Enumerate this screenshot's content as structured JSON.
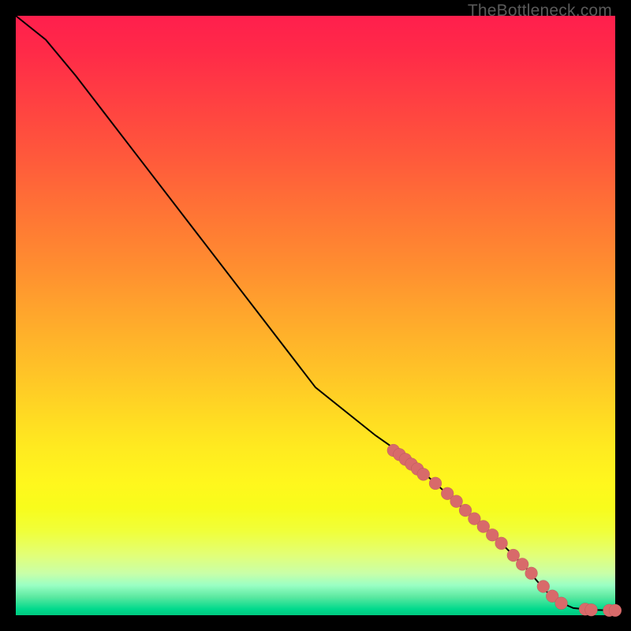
{
  "watermark": "TheBottleneck.com",
  "chart_data": {
    "type": "line",
    "title": "",
    "xlabel": "",
    "ylabel": "",
    "xlim": [
      0,
      100
    ],
    "ylim": [
      0,
      100
    ],
    "grid": false,
    "legend": false,
    "curve": [
      {
        "x": 0,
        "y": 100
      },
      {
        "x": 5,
        "y": 96
      },
      {
        "x": 10,
        "y": 90
      },
      {
        "x": 20,
        "y": 77
      },
      {
        "x": 30,
        "y": 64
      },
      {
        "x": 40,
        "y": 51
      },
      {
        "x": 50,
        "y": 38
      },
      {
        "x": 60,
        "y": 30
      },
      {
        "x": 65,
        "y": 26.5
      },
      {
        "x": 70,
        "y": 22
      },
      {
        "x": 75,
        "y": 17.5
      },
      {
        "x": 80,
        "y": 13
      },
      {
        "x": 85,
        "y": 8
      },
      {
        "x": 88,
        "y": 4.5
      },
      {
        "x": 90,
        "y": 2.5
      },
      {
        "x": 93,
        "y": 1.2
      },
      {
        "x": 96,
        "y": 0.9
      },
      {
        "x": 100,
        "y": 0.8
      }
    ],
    "points": [
      {
        "x": 63,
        "y": 27.5
      },
      {
        "x": 64,
        "y": 26.8
      },
      {
        "x": 65,
        "y": 26.0
      },
      {
        "x": 66,
        "y": 25.2
      },
      {
        "x": 67,
        "y": 24.4
      },
      {
        "x": 68,
        "y": 23.5
      },
      {
        "x": 70,
        "y": 22.0
      },
      {
        "x": 72,
        "y": 20.3
      },
      {
        "x": 73.5,
        "y": 19.0
      },
      {
        "x": 75,
        "y": 17.5
      },
      {
        "x": 76.5,
        "y": 16.1
      },
      {
        "x": 78,
        "y": 14.8
      },
      {
        "x": 79.5,
        "y": 13.4
      },
      {
        "x": 81,
        "y": 12.0
      },
      {
        "x": 83,
        "y": 10.0
      },
      {
        "x": 84.5,
        "y": 8.5
      },
      {
        "x": 86,
        "y": 7.0
      },
      {
        "x": 88,
        "y": 4.8
      },
      {
        "x": 89.5,
        "y": 3.2
      },
      {
        "x": 91,
        "y": 2.0
      },
      {
        "x": 95,
        "y": 1.0
      },
      {
        "x": 96,
        "y": 0.9
      },
      {
        "x": 99,
        "y": 0.8
      },
      {
        "x": 100,
        "y": 0.8
      }
    ],
    "point_radius_px": 8,
    "colors": {
      "line": "#000000",
      "point_fill": "#d86a6a",
      "gradient_top": "#ff1f4d",
      "gradient_bottom": "#00c97f"
    }
  }
}
